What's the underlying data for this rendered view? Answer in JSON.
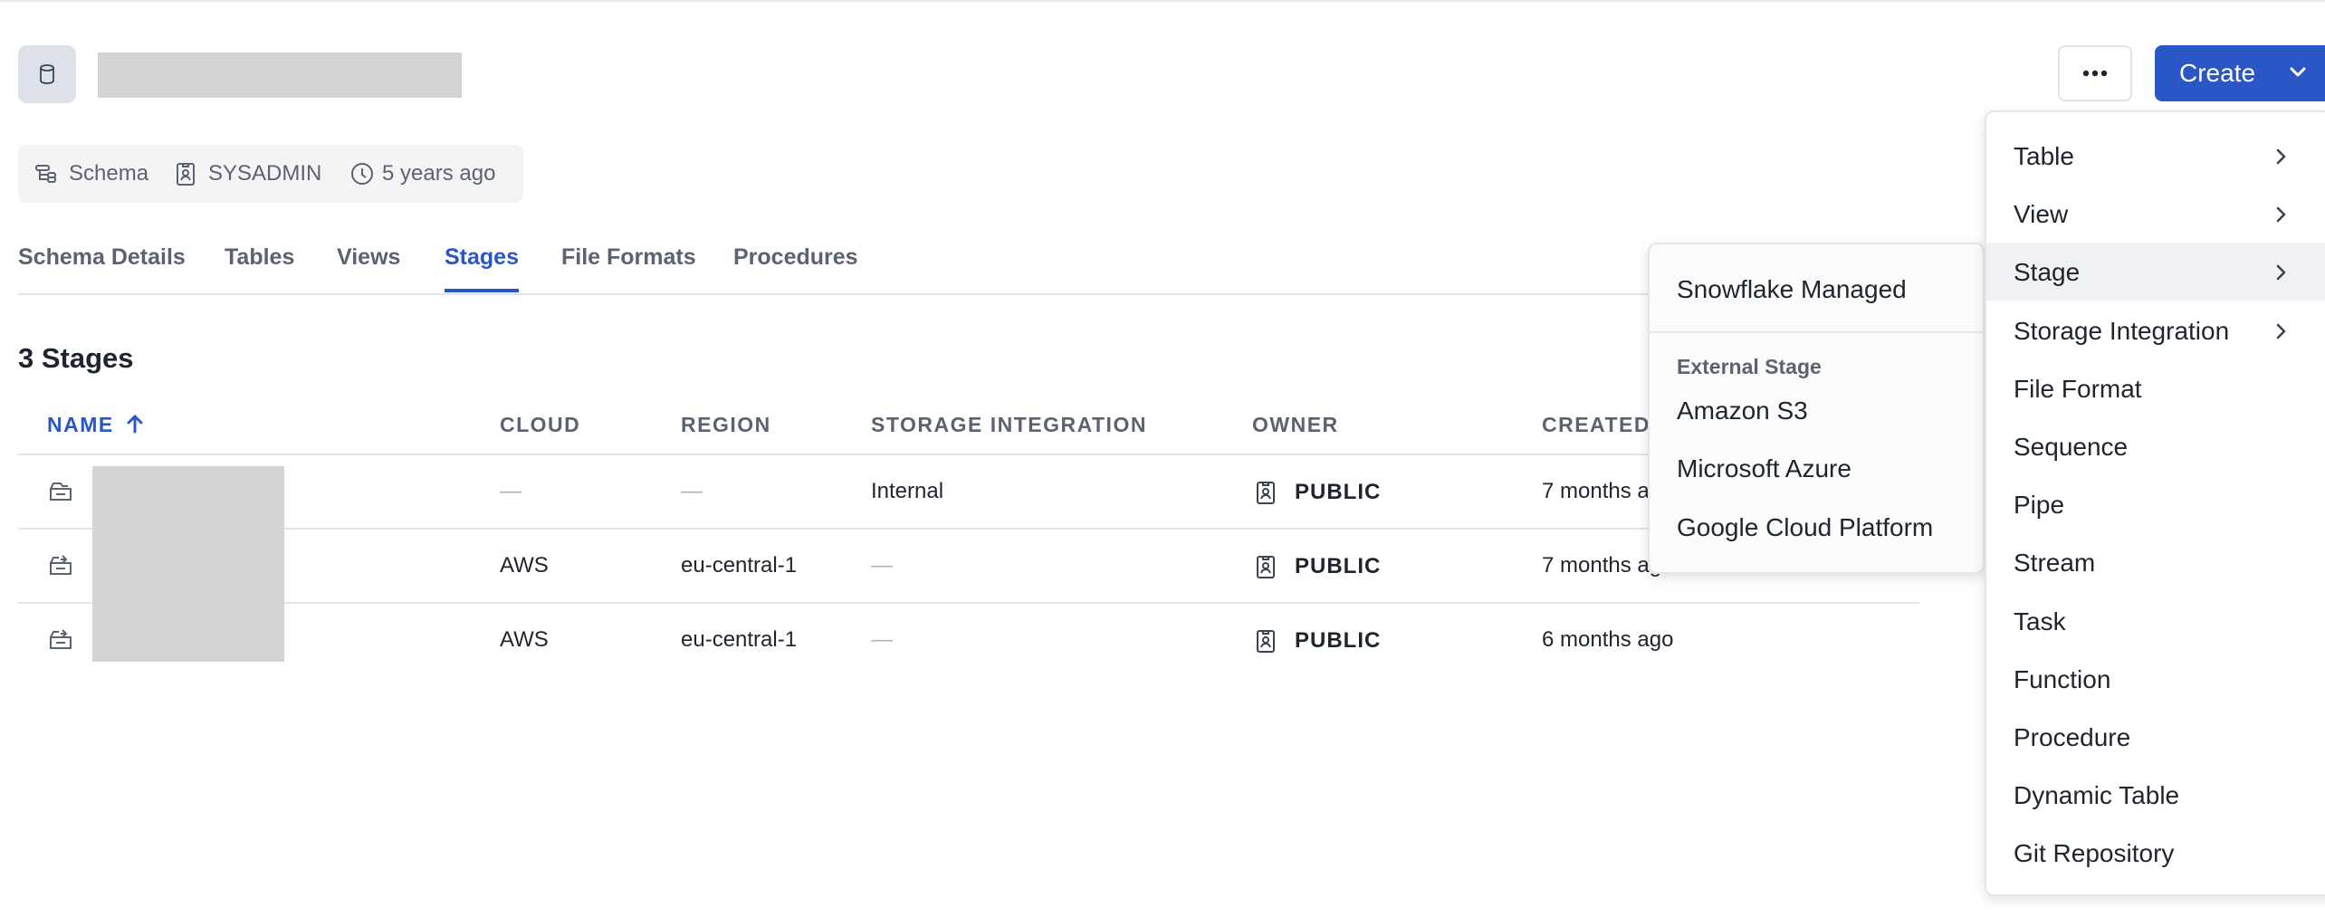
{
  "header": {
    "more_label": "•••",
    "create_label": "Create"
  },
  "meta": {
    "type": "Schema",
    "owner": "SYSADMIN",
    "created": "5 years ago"
  },
  "tabs": [
    {
      "label": "Schema Details"
    },
    {
      "label": "Tables"
    },
    {
      "label": "Views"
    },
    {
      "label": "Stages",
      "active": true
    },
    {
      "label": "File Formats"
    },
    {
      "label": "Procedures"
    }
  ],
  "count_heading": "3 Stages",
  "table": {
    "columns": [
      "NAME",
      "CLOUD",
      "REGION",
      "STORAGE INTEGRATION",
      "OWNER",
      "CREATED"
    ],
    "sort": {
      "column": "NAME",
      "direction": "asc"
    },
    "rows": [
      {
        "cloud": "—",
        "region": "—",
        "storage_integration": "Internal",
        "owner": "PUBLIC",
        "created": "7 months ago"
      },
      {
        "cloud": "AWS",
        "region": "eu-central-1",
        "storage_integration": "—",
        "owner": "PUBLIC",
        "created": "7 months ago"
      },
      {
        "cloud": "AWS",
        "region": "eu-central-1",
        "storage_integration": "—",
        "owner": "PUBLIC",
        "created": "6 months ago"
      }
    ]
  },
  "create_menu": {
    "items": [
      {
        "label": "Table",
        "has_submenu": true
      },
      {
        "label": "View",
        "has_submenu": true
      },
      {
        "label": "Stage",
        "has_submenu": true,
        "highlighted": true
      },
      {
        "label": "Storage Integration",
        "has_submenu": true
      },
      {
        "label": "File Format"
      },
      {
        "label": "Sequence"
      },
      {
        "label": "Pipe"
      },
      {
        "label": "Stream"
      },
      {
        "label": "Task"
      },
      {
        "label": "Function"
      },
      {
        "label": "Procedure"
      },
      {
        "label": "Dynamic Table"
      },
      {
        "label": "Git Repository"
      }
    ]
  },
  "stage_submenu": {
    "managed": "Snowflake Managed",
    "external_group": "External Stage",
    "external": [
      "Amazon S3",
      "Microsoft Azure",
      "Google Cloud Platform"
    ]
  },
  "colors": {
    "accent": "#2a56c6",
    "muted_text": "#5b6272",
    "redaction": "#d3d4d6",
    "highlight": "#f0f1f4"
  },
  "icons": {
    "database": "database-icon",
    "schema": "schema-icon",
    "owner": "user-badge-icon",
    "clock": "clock-icon",
    "stage_internal": "internal-stage-icon",
    "stage_external": "external-stage-icon",
    "sort": "arrow-up-icon",
    "submenu": "chevron-right-icon",
    "dropdown": "chevron-down-icon"
  }
}
